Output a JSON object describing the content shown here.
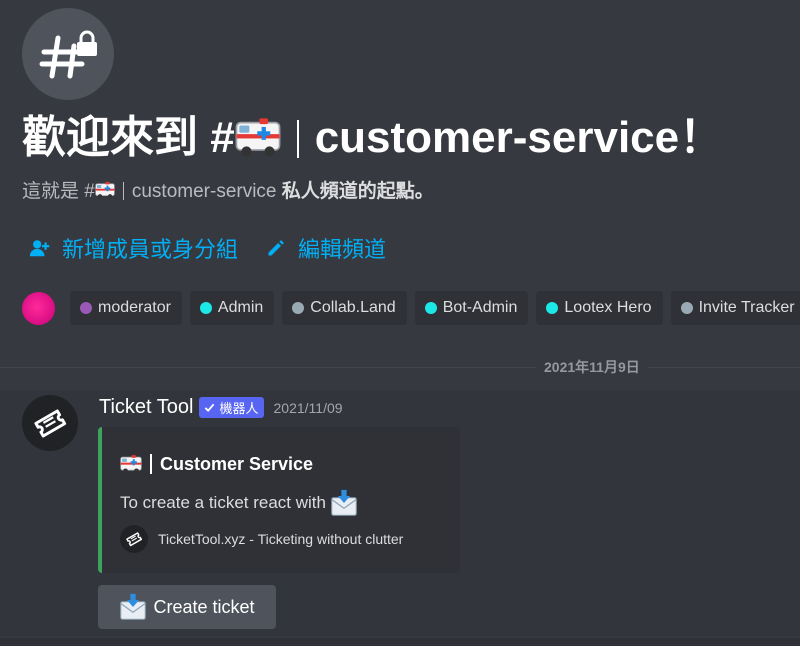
{
  "welcome": {
    "title_prefix": "歡迎來到 #",
    "channel_name": "customer-service",
    "title_suffix": "！",
    "subtitle_prefix": "這就是 #",
    "subtitle_channel": "customer-service",
    "subtitle_suffix": "私人頻道的起點。"
  },
  "actions": {
    "add_members": "新增成員或身分組",
    "edit_channel": "編輯頻道"
  },
  "roles": [
    {
      "name": "moderator",
      "color": "#9b59b6"
    },
    {
      "name": "Admin",
      "color": "#1ce8e8"
    },
    {
      "name": "Collab.Land",
      "color": "#99aab5"
    },
    {
      "name": "Bot-Admin",
      "color": "#1ce8e8"
    },
    {
      "name": "Lootex Hero",
      "color": "#1ce8e8"
    },
    {
      "name": "Invite Tracker",
      "color": "#99aab5"
    }
  ],
  "divider": {
    "date": "2021年11月9日"
  },
  "message": {
    "author": "Ticket Tool",
    "bot_tag": "機器人",
    "timestamp": "2021/11/09",
    "embed": {
      "accent_color": "#3ba55d",
      "title": "Customer Service",
      "description": "To create a ticket react with",
      "footer": "TicketTool.xyz - Ticketing without clutter"
    },
    "button_label": "Create ticket"
  },
  "icons": {
    "channel": "hash-lock-icon",
    "ambulance": "ambulance-icon",
    "envelope": "incoming-envelope-icon",
    "ticket": "ticket-icon"
  }
}
